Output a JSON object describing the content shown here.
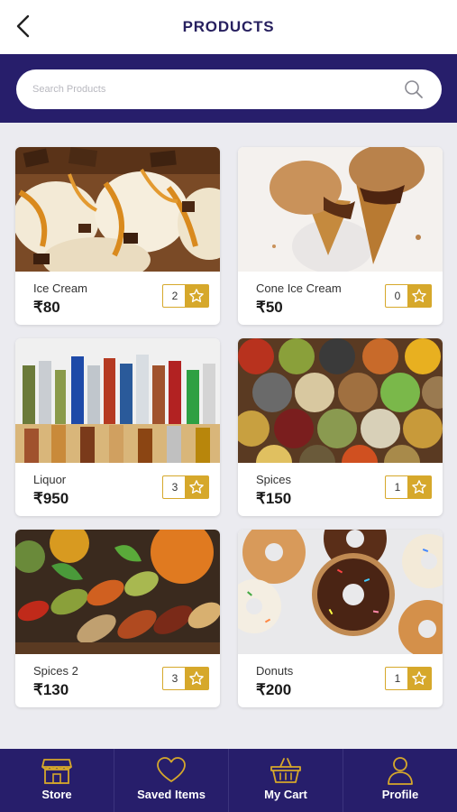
{
  "header": {
    "title": "PRODUCTS",
    "back_icon": "chevron-left-icon"
  },
  "search": {
    "placeholder": "Search Products",
    "value": "",
    "icon": "search-icon"
  },
  "products": [
    {
      "name": "Ice Cream",
      "price": "₹80",
      "count": "2",
      "image": "ice-cream-scoops"
    },
    {
      "name": "Cone Ice Cream",
      "price": "₹50",
      "count": "0",
      "image": "ice-cream-cones"
    },
    {
      "name": "Liquor",
      "price": "₹950",
      "count": "3",
      "image": "liquor-bottles"
    },
    {
      "name": "Spices",
      "price": "₹150",
      "count": "1",
      "image": "spice-bowls"
    },
    {
      "name": "Spices 2",
      "price": "₹130",
      "count": "3",
      "image": "spice-scoops"
    },
    {
      "name": "Donuts",
      "price": "₹200",
      "count": "1",
      "image": "donuts"
    }
  ],
  "nav": [
    {
      "label": "Store",
      "icon": "store-icon"
    },
    {
      "label": "Saved Items",
      "icon": "heart-icon"
    },
    {
      "label": "My Cart",
      "icon": "basket-icon"
    },
    {
      "label": "Profile",
      "icon": "user-icon"
    }
  ],
  "colors": {
    "brand": "#271e6b",
    "accent": "#d6a82b",
    "background": "#ebebf0",
    "title": "#27205f"
  }
}
